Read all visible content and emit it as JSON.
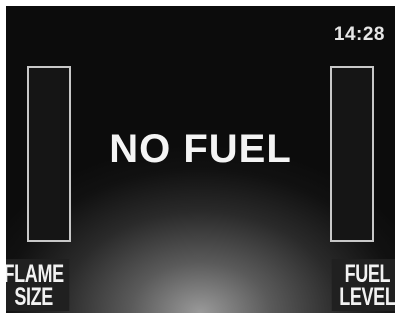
{
  "header": {
    "clock": "14:28"
  },
  "display": {
    "status_message": "NO FUEL"
  },
  "gauges": {
    "flame_size": {
      "label_line1": "FLAME",
      "label_line2": "SIZE",
      "level": 0
    },
    "fuel_level": {
      "label_line1": "FUEL",
      "label_line2": "LEVEL",
      "level": 0
    }
  },
  "colors": {
    "gauge_border": "#c8c8c8",
    "gauge_fill": "#d08a1c",
    "text": "#f4f4f4"
  }
}
